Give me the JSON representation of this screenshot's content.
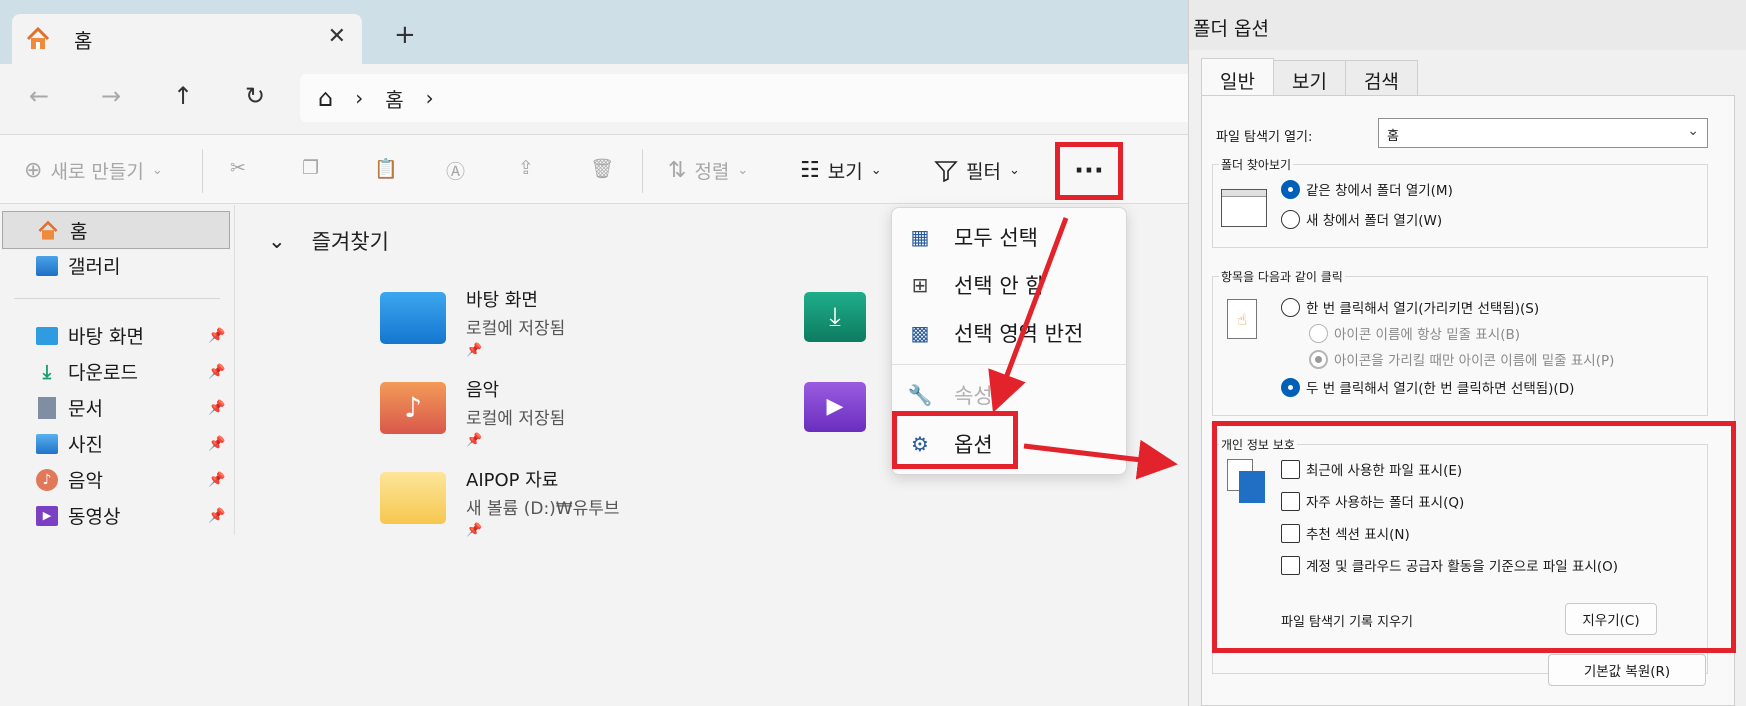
{
  "explorer": {
    "tab_title": "홈",
    "tab_close": "✕",
    "tab_new": "+",
    "nav": {
      "back": "←",
      "forward": "→",
      "up": "↑",
      "refresh": "↻"
    },
    "breadcrumb": {
      "home_icon": "⌂",
      "sep": "›",
      "item": "홈"
    },
    "commands": {
      "new": "새로 만들기",
      "sort": "정렬",
      "view": "보기",
      "filter": "필터",
      "more": "···"
    },
    "sidebar": {
      "home": "홈",
      "gallery": "갤러리",
      "pinned": [
        {
          "label": "바탕 화면",
          "icon": "desktop-icon"
        },
        {
          "label": "다운로드",
          "icon": "download-icon"
        },
        {
          "label": "문서",
          "icon": "document-icon"
        },
        {
          "label": "사진",
          "icon": "picture-icon"
        },
        {
          "label": "음악",
          "icon": "music-icon"
        },
        {
          "label": "동영상",
          "icon": "video-icon"
        }
      ]
    },
    "quick_access": {
      "title": "즐겨찾기",
      "folders": [
        {
          "name": "바탕 화면",
          "sub": "로컬에 저장됨"
        },
        {
          "name": "음악",
          "sub": "로컬에 저장됨"
        },
        {
          "name": "AIPOP 자료",
          "sub": "새 볼륨 (D:)₩유투브"
        }
      ]
    }
  },
  "menu": {
    "items": [
      {
        "label": "모두 선택"
      },
      {
        "label": "선택 안 함"
      },
      {
        "label": "선택 영역 반전"
      },
      {
        "label": "속성"
      },
      {
        "label": "옵션"
      }
    ]
  },
  "dialog": {
    "title": "폴더 옵션",
    "tabs": [
      "일반",
      "보기",
      "검색"
    ],
    "open_explorer_label": "파일 탐색기 열기:",
    "open_explorer_value": "홈",
    "browse_group": {
      "title": "폴더 찾아보기",
      "same_window": "같은 창에서 폴더 열기(M)",
      "new_window": "새 창에서 폴더 열기(W)"
    },
    "click_group": {
      "title": "항목을 다음과 같이 클릭",
      "single": "한 번 클릭해서 열기(가리키면 선택됨)(S)",
      "underline_always": "아이콘 이름에 항상 밑줄 표시(B)",
      "underline_hover": "아이콘을 가리킬 때만 아이콘 이름에 밑줄 표시(P)",
      "double": "두 번 클릭해서 열기(한 번 클릭하면 선택됨)(D)"
    },
    "privacy_group": {
      "title": "개인 정보 보호",
      "recent_files": "최근에 사용한 파일 표시(E)",
      "frequent_folders": "자주 사용하는 폴더 표시(Q)",
      "recommended": "추천 섹션 표시(N)",
      "cloud_files": "계정 및 클라우드 공급자 활동을 기준으로 파일 표시(O)",
      "clear_label": "파일 탐색기 기록 지우기",
      "clear_button": "지우기(C)"
    },
    "restore_button": "기본값 복원(R)"
  },
  "colors": {
    "highlight": "#e2232b",
    "accent": "#005fb8"
  }
}
